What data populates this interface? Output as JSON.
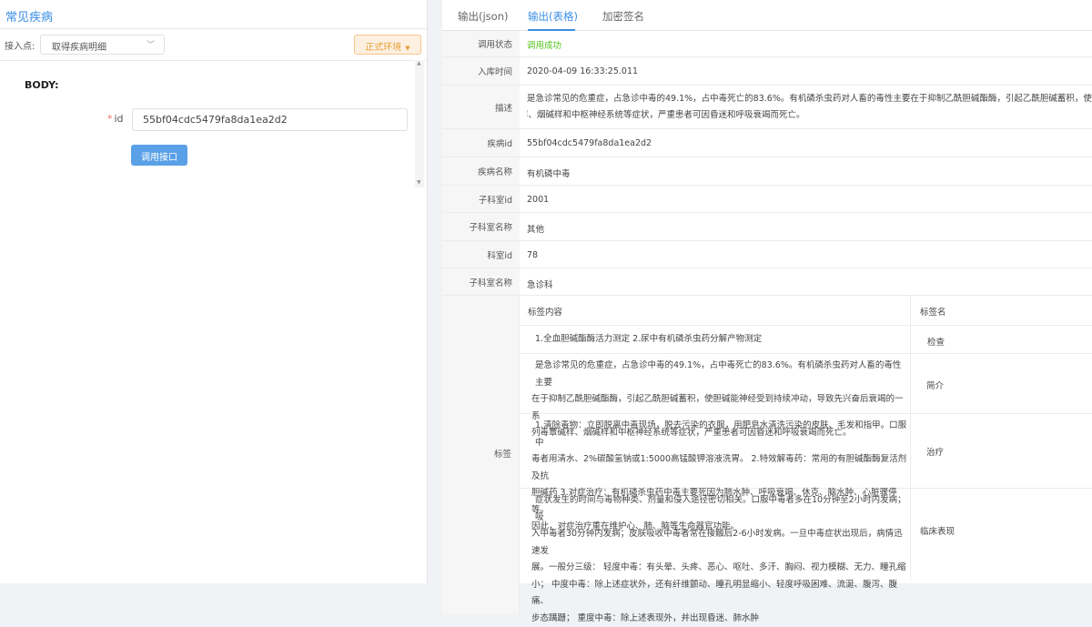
{
  "left": {
    "title": "常见疾病",
    "endpoint_label": "接入点:",
    "endpoint_value": "取得疾病明细",
    "env_label": "正式环境",
    "body_label": "BODY:",
    "id_label": "id",
    "id_value": "55bf04cdc5479fa8da1ea2d2",
    "call_button": "调用接口"
  },
  "tabs": [
    "输出(json)",
    "输出(表格)",
    "加密签名"
  ],
  "active_tab": "输出(表格)",
  "result": {
    "status_key": "调用状态",
    "status_value": "调用成功",
    "time_key": "入库时间",
    "time_value": "2020-04-09 16:33:25.011",
    "desc_key": "描述",
    "desc_line1": "是急诊常见的危重症，占急诊中毒的49.1%，占中毒死亡的83.6%。有机磷杀虫药对人畜的毒性主要在于抑制乙酰胆碱酯酶，引起乙酰胆碱蓄积，使胆碱能",
    "desc_line2": "样、烟碱样和中枢神经系统等症状，严重患者可因昏迷和呼吸衰竭而死亡。",
    "disease_id_key": "疾病id",
    "disease_id_value": "55bf04cdc5479fa8da1ea2d2",
    "disease_name_key": "疾病名称",
    "disease_name_value": "有机磷中毒",
    "sub_dept_id_key": "子科室id",
    "sub_dept_id_value": "2001",
    "sub_dept_name_key": "子科室名称",
    "sub_dept_name_value": "其他",
    "dept_id_key": "科室id",
    "dept_id_value": "78",
    "dept_name_key": "子科室名称",
    "dept_name_value": "急诊科",
    "tags_key": "标签",
    "tags_header_content": "标签内容",
    "tags_header_name": "标签名",
    "tags": [
      {
        "content": [
          "1.全血胆碱酯酶活力测定 2.尿中有机磷杀虫药分解产物测定"
        ],
        "name": "检查"
      },
      {
        "content": [
          "是急诊常见的危重症，占急诊中毒的49.1%，占中毒死亡的83.6%。有机磷杀虫药对人畜的毒性主要",
          "在于抑制乙酰胆碱酯酶，引起乙酰胆碱蓄积，使胆碱能神经受到持续冲动，导致先兴奋后衰竭的一系",
          "列毒蕈碱样、烟碱样和中枢神经系统等症状，严重患者可因昏迷和呼吸衰竭而死亡。"
        ],
        "name": "简介"
      },
      {
        "content": [
          "1.清除毒物：立即脱离中毒现场，脱去污染的衣服，用肥皂水清洗污染的皮肤、毛发和指甲。口服中",
          "毒者用清水、2%碳酸氢钠或1:5000高锰酸钾溶液洗胃。 2.特效解毒药：常用的有胆碱酯酶复活剂及抗",
          "胆碱药 3.对症治疗：有机磷杀虫药中毒主要死因为肺水肿、呼吸衰竭、休克、脑水肿、心脏骤停等。",
          "因此，对症治疗重在维护心、肺、脑等生命器官功能。"
        ],
        "name": "治疗"
      },
      {
        "content": [
          "症状发生的时间与毒物种类、剂量和侵入途径密切相关。口服中毒者多在10分钟至2小时内发病；吸",
          "入中毒者30分钟内发病；皮肤吸收中毒者常在接触后2-6小时发病。一旦中毒症状出现后，病情迅速发",
          "展。一般分三级： 轻度中毒：有头晕、头疼、恶心、呕吐、多汗、胸闷、视力模糊、无力、瞳孔缩",
          "小； 中度中毒：除上述症状外，还有纤维颤动、瞳孔明显缩小、轻度呼吸困难、流涎、腹泻、腹痛、",
          "步态蹒跚； 重度中毒：除上述表现外，并出现昏迷、肺水肿"
        ],
        "name": "临床表现"
      }
    ]
  }
}
